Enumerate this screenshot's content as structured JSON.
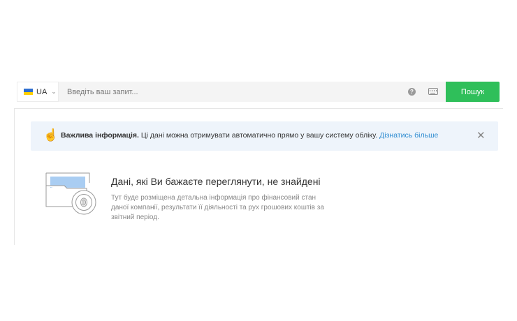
{
  "search": {
    "language": "UA",
    "placeholder": "Введіть ваш запит...",
    "value": "",
    "help_icon": "help-icon",
    "keyboard_icon": "keyboard-icon",
    "button_label": "Пошук",
    "button_color": "#2fbf5a"
  },
  "info": {
    "icon": "pointing-hand-icon",
    "bold_text": "Важлива інформація.",
    "text": " Ці дані можна отримувати автоматично прямо у вашу систему обліку. ",
    "link_text": "Дізнатись більше",
    "close_icon": "close-icon",
    "background": "#eef4fb"
  },
  "empty_state": {
    "illustration": "folder-fingerprint-illustration",
    "title": "Дані, які Ви бажаєте переглянути, не знайдені",
    "description": "Тут буде розміщена детальна інформація про фінансовий стан даної компанії, результати її діяльності та рух грошових коштів за звітний період."
  }
}
